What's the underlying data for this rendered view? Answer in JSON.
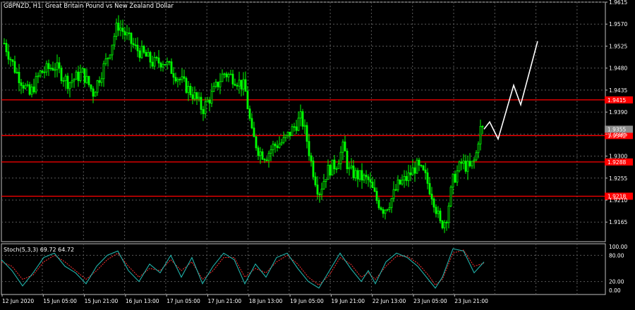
{
  "chart_title": "GBPNZD, H1:  Great Britain Pound vs New Zealand Dollar",
  "colors": {
    "background": "#000000",
    "grid": "#5a5a5a",
    "candles": "#00ff00",
    "levels": "#ff0000",
    "projection": "#ffffff",
    "stoch_main": "#20b2aa",
    "stoch_signal": "#ff3030",
    "axis_text": "#ffffff",
    "current_price_box": "#8c8c8c"
  },
  "price_axis": {
    "min": 1.9125,
    "max": 1.9615,
    "ticks": [
      "1.9615",
      "1.9570",
      "1.9525",
      "1.9480",
      "1.9435",
      "1.9390",
      "1.9345",
      "1.9300",
      "1.9255",
      "1.9210",
      "1.9165"
    ]
  },
  "levels": [
    {
      "label": "1.9415",
      "value": 1.9415
    },
    {
      "label": "1.9342",
      "value": 1.9342
    },
    {
      "label": "1.9288",
      "value": 1.9288
    },
    {
      "label": "1.9218",
      "value": 1.9218
    }
  ],
  "current_price": {
    "label": "1.9355",
    "value": 1.9355
  },
  "time_axis": [
    "12 Jun 2020",
    "15 Jun 05:00",
    "15 Jun 21:00",
    "16 Jun 13:00",
    "17 Jun 05:00",
    "17 Jun 21:00",
    "18 Jun 13:00",
    "19 Jun 05:00",
    "19 Jun 21:00",
    "22 Jun 13:00",
    "23 Jun 05:00",
    "23 Jun 21:00"
  ],
  "stochastic": {
    "label": "Stoch(5,3,3) 69.72 64.72",
    "ticks": [
      "100.00",
      "80.00",
      "20.00",
      "0.00"
    ],
    "levels": [
      80,
      20
    ]
  },
  "chart_data": {
    "type": "candlestick",
    "symbol": "GBPNZD",
    "timeframe": "H1",
    "close_path": [
      [
        0,
        1.9545
      ],
      [
        20,
        1.9475
      ],
      [
        40,
        1.9425
      ],
      [
        55,
        1.947
      ],
      [
        75,
        1.9485
      ],
      [
        95,
        1.945
      ],
      [
        115,
        1.947
      ],
      [
        130,
        1.943
      ],
      [
        150,
        1.95
      ],
      [
        165,
        1.957
      ],
      [
        180,
        1.954
      ],
      [
        190,
        1.952
      ],
      [
        200,
        1.951
      ],
      [
        215,
        1.949
      ],
      [
        230,
        1.9495
      ],
      [
        245,
        1.947
      ],
      [
        260,
        1.9445
      ],
      [
        275,
        1.942
      ],
      [
        285,
        1.9395
      ],
      [
        300,
        1.943
      ],
      [
        315,
        1.947
      ],
      [
        330,
        1.946
      ],
      [
        345,
        1.944
      ],
      [
        355,
        1.9345
      ],
      [
        365,
        1.931
      ],
      [
        375,
        1.93
      ],
      [
        385,
        1.932
      ],
      [
        400,
        1.933
      ],
      [
        415,
        1.936
      ],
      [
        425,
        1.938
      ],
      [
        432,
        1.934
      ],
      [
        440,
        1.928
      ],
      [
        450,
        1.9225
      ],
      [
        462,
        1.927
      ],
      [
        475,
        1.9285
      ],
      [
        485,
        1.932
      ],
      [
        492,
        1.927
      ],
      [
        505,
        1.926
      ],
      [
        520,
        1.925
      ],
      [
        532,
        1.921
      ],
      [
        542,
        1.919
      ],
      [
        552,
        1.921
      ],
      [
        562,
        1.924
      ],
      [
        575,
        1.9255
      ],
      [
        588,
        1.928
      ],
      [
        600,
        1.926
      ],
      [
        612,
        1.9215
      ],
      [
        622,
        1.916
      ],
      [
        630,
        1.917
      ],
      [
        640,
        1.925
      ],
      [
        652,
        1.9285
      ],
      [
        664,
        1.9275
      ],
      [
        672,
        1.9295
      ],
      [
        678,
        1.9355
      ],
      [
        684,
        1.9355
      ]
    ],
    "projection_path": [
      [
        684,
        1.9355
      ],
      [
        692,
        1.937
      ],
      [
        704,
        1.9335
      ],
      [
        726,
        1.9445
      ],
      [
        736,
        1.9405
      ],
      [
        760,
        1.9535
      ]
    ],
    "stoch_main": [
      [
        0,
        70
      ],
      [
        15,
        45
      ],
      [
        30,
        10
      ],
      [
        45,
        40
      ],
      [
        60,
        75
      ],
      [
        75,
        85
      ],
      [
        90,
        55
      ],
      [
        105,
        40
      ],
      [
        120,
        15
      ],
      [
        135,
        55
      ],
      [
        150,
        80
      ],
      [
        165,
        90
      ],
      [
        180,
        45
      ],
      [
        195,
        20
      ],
      [
        210,
        60
      ],
      [
        225,
        40
      ],
      [
        240,
        80
      ],
      [
        255,
        30
      ],
      [
        270,
        75
      ],
      [
        285,
        15
      ],
      [
        300,
        55
      ],
      [
        315,
        85
      ],
      [
        330,
        70
      ],
      [
        345,
        15
      ],
      [
        360,
        60
      ],
      [
        375,
        30
      ],
      [
        390,
        75
      ],
      [
        405,
        85
      ],
      [
        420,
        50
      ],
      [
        435,
        20
      ],
      [
        450,
        5
      ],
      [
        465,
        45
      ],
      [
        480,
        85
      ],
      [
        495,
        50
      ],
      [
        510,
        20
      ],
      [
        520,
        45
      ],
      [
        530,
        15
      ],
      [
        545,
        65
      ],
      [
        560,
        85
      ],
      [
        575,
        75
      ],
      [
        590,
        55
      ],
      [
        605,
        25
      ],
      [
        615,
        5
      ],
      [
        625,
        30
      ],
      [
        640,
        95
      ],
      [
        655,
        90
      ],
      [
        670,
        40
      ],
      [
        684,
        65
      ]
    ],
    "stoch_signal": [
      [
        0,
        65
      ],
      [
        15,
        55
      ],
      [
        30,
        25
      ],
      [
        45,
        35
      ],
      [
        60,
        65
      ],
      [
        75,
        80
      ],
      [
        90,
        65
      ],
      [
        105,
        45
      ],
      [
        120,
        25
      ],
      [
        135,
        45
      ],
      [
        150,
        70
      ],
      [
        165,
        85
      ],
      [
        180,
        55
      ],
      [
        195,
        30
      ],
      [
        210,
        50
      ],
      [
        225,
        45
      ],
      [
        240,
        70
      ],
      [
        255,
        45
      ],
      [
        270,
        65
      ],
      [
        285,
        25
      ],
      [
        300,
        45
      ],
      [
        315,
        75
      ],
      [
        330,
        75
      ],
      [
        345,
        30
      ],
      [
        360,
        50
      ],
      [
        375,
        40
      ],
      [
        390,
        65
      ],
      [
        405,
        80
      ],
      [
        420,
        60
      ],
      [
        435,
        30
      ],
      [
        450,
        12
      ],
      [
        465,
        35
      ],
      [
        480,
        75
      ],
      [
        495,
        60
      ],
      [
        510,
        30
      ],
      [
        520,
        40
      ],
      [
        530,
        25
      ],
      [
        545,
        55
      ],
      [
        560,
        78
      ],
      [
        575,
        78
      ],
      [
        590,
        62
      ],
      [
        605,
        35
      ],
      [
        615,
        12
      ],
      [
        625,
        25
      ],
      [
        640,
        85
      ],
      [
        655,
        92
      ],
      [
        670,
        55
      ],
      [
        684,
        62
      ]
    ]
  }
}
